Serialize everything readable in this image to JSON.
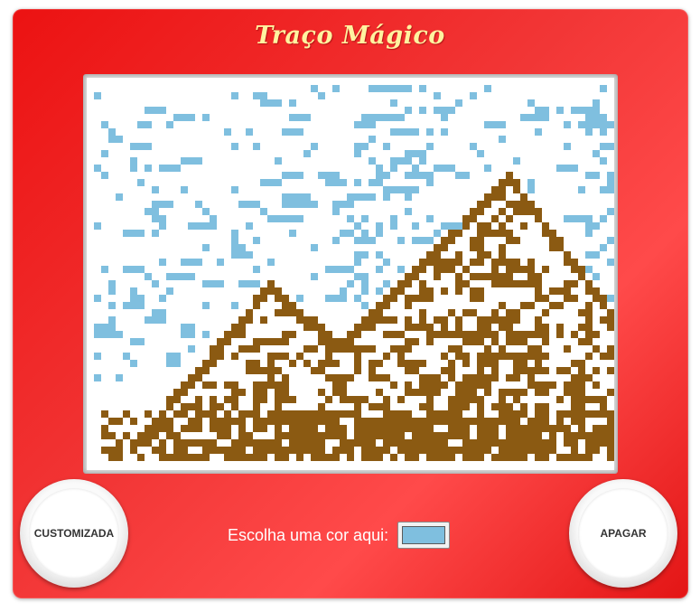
{
  "title": "Traço Mágico",
  "buttons": {
    "custom_label": "CUSTOMIZADA",
    "clear_label": "APAGAR"
  },
  "color_picker": {
    "label": "Escolha uma cor aqui:",
    "value": "#7fbfdf"
  },
  "colors": {
    "frame": "#ec1212",
    "title_text": "#fff3a0",
    "drawing_brown": "#8b5a12",
    "drawing_blue": "#7fbfdf"
  },
  "grid": {
    "cols": 73,
    "rows": 54
  }
}
